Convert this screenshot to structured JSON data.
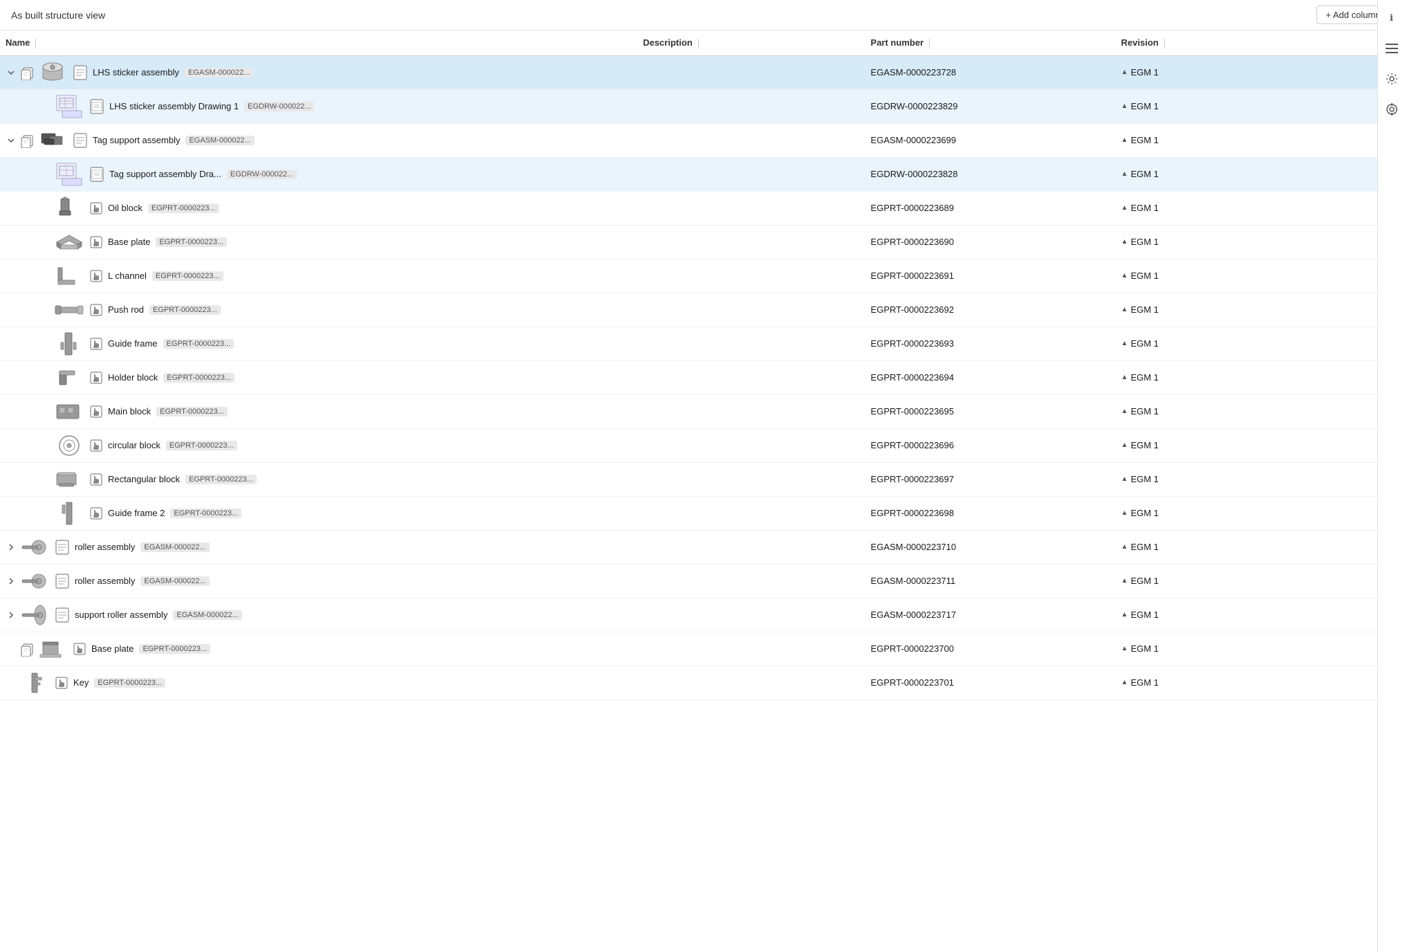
{
  "header": {
    "title": "As built structure view",
    "add_columns_label": "+ Add columns"
  },
  "columns": [
    {
      "key": "name",
      "label": "Name"
    },
    {
      "key": "description",
      "label": "Description"
    },
    {
      "key": "part_number",
      "label": "Part number"
    },
    {
      "key": "revision",
      "label": "Revision"
    }
  ],
  "rows": [
    {
      "id": 1,
      "indent": 0,
      "expandable": true,
      "expanded": true,
      "selected": true,
      "has_copy_icon": true,
      "has_thumbnail": true,
      "thumbnail_type": "assembly3d",
      "type": "assembly",
      "name": "LHS sticker assembly",
      "tag": "EGASM-000022...",
      "description": "",
      "part_number": "EGASM-0000223728",
      "revision": "EGM 1"
    },
    {
      "id": 2,
      "indent": 1,
      "expandable": false,
      "expanded": false,
      "selected": false,
      "light_selected": true,
      "has_thumbnail": true,
      "thumbnail_type": "drawing",
      "type": "document",
      "name": "LHS sticker assembly Drawing 1",
      "tag": "EGDRW-000022...",
      "description": "",
      "part_number": "EGDRW-0000223829",
      "revision": "EGM 1"
    },
    {
      "id": 3,
      "indent": 0,
      "expandable": true,
      "expanded": true,
      "selected": false,
      "has_copy_icon": true,
      "has_thumbnail": true,
      "thumbnail_type": "assembly3d_dark",
      "type": "assembly",
      "name": "Tag support assembly",
      "tag": "EGASM-000022...",
      "description": "",
      "part_number": "EGASM-0000223699",
      "revision": "EGM 1"
    },
    {
      "id": 4,
      "indent": 1,
      "expandable": false,
      "expanded": false,
      "selected": false,
      "light_selected": true,
      "has_thumbnail": true,
      "thumbnail_type": "drawing2",
      "type": "document",
      "name": "Tag support assembly Dra...",
      "tag": "EGDRW-000022...",
      "description": "",
      "part_number": "EGDRW-0000223828",
      "revision": "EGM 1"
    },
    {
      "id": 5,
      "indent": 1,
      "expandable": false,
      "selected": false,
      "has_thumbnail": true,
      "thumbnail_type": "part_oil",
      "type": "part",
      "name": "Oil block",
      "tag": "EGPRT-0000223...",
      "description": "",
      "part_number": "EGPRT-0000223689",
      "revision": "EGM 1"
    },
    {
      "id": 6,
      "indent": 1,
      "expandable": false,
      "selected": false,
      "has_thumbnail": true,
      "thumbnail_type": "part_base",
      "type": "part",
      "name": "Base plate",
      "tag": "EGPRT-0000223...",
      "description": "",
      "part_number": "EGPRT-0000223690",
      "revision": "EGM 1"
    },
    {
      "id": 7,
      "indent": 1,
      "expandable": false,
      "selected": false,
      "has_thumbnail": true,
      "thumbnail_type": "part_lchannel",
      "type": "part",
      "name": "L channel",
      "tag": "EGPRT-0000223...",
      "description": "",
      "part_number": "EGPRT-0000223691",
      "revision": "EGM 1"
    },
    {
      "id": 8,
      "indent": 1,
      "expandable": false,
      "selected": false,
      "has_thumbnail": true,
      "thumbnail_type": "part_pushrod",
      "type": "part",
      "name": "Push rod",
      "tag": "EGPRT-0000223...",
      "description": "",
      "part_number": "EGPRT-0000223692",
      "revision": "EGM 1"
    },
    {
      "id": 9,
      "indent": 1,
      "expandable": false,
      "selected": false,
      "has_thumbnail": true,
      "thumbnail_type": "part_guide",
      "type": "part",
      "name": "Guide frame",
      "tag": "EGPRT-0000223...",
      "description": "",
      "part_number": "EGPRT-0000223693",
      "revision": "EGM 1"
    },
    {
      "id": 10,
      "indent": 1,
      "expandable": false,
      "selected": false,
      "has_thumbnail": true,
      "thumbnail_type": "part_holder",
      "type": "part",
      "name": "Holder block",
      "tag": "EGPRT-0000223...",
      "description": "",
      "part_number": "EGPRT-0000223694",
      "revision": "EGM 1"
    },
    {
      "id": 11,
      "indent": 1,
      "expandable": false,
      "selected": false,
      "has_thumbnail": true,
      "thumbnail_type": "part_main",
      "type": "part",
      "name": "Main block",
      "tag": "EGPRT-0000223...",
      "description": "",
      "part_number": "EGPRT-0000223695",
      "revision": "EGM 1"
    },
    {
      "id": 12,
      "indent": 1,
      "expandable": false,
      "selected": false,
      "has_thumbnail": true,
      "thumbnail_type": "part_circular",
      "type": "part",
      "name": "circular block",
      "tag": "EGPRT-0000223...",
      "description": "",
      "part_number": "EGPRT-0000223696",
      "revision": "EGM 1"
    },
    {
      "id": 13,
      "indent": 1,
      "expandable": false,
      "selected": false,
      "has_thumbnail": true,
      "thumbnail_type": "part_rect",
      "type": "part",
      "name": "Rectangular block",
      "tag": "EGPRT-0000223...",
      "description": "",
      "part_number": "EGPRT-0000223697",
      "revision": "EGM 1"
    },
    {
      "id": 14,
      "indent": 1,
      "expandable": false,
      "selected": false,
      "has_thumbnail": true,
      "thumbnail_type": "part_guide2",
      "type": "part",
      "name": "Guide frame 2",
      "tag": "EGPRT-0000223...",
      "description": "",
      "part_number": "EGPRT-0000223698",
      "revision": "EGM 1"
    },
    {
      "id": 15,
      "indent": 0,
      "expandable": true,
      "expanded": false,
      "selected": false,
      "has_thumbnail": true,
      "thumbnail_type": "part_roller",
      "type": "assembly",
      "name": "roller assembly",
      "tag": "EGASM-000022...",
      "description": "",
      "part_number": "EGASM-0000223710",
      "revision": "EGM 1"
    },
    {
      "id": 16,
      "indent": 0,
      "expandable": true,
      "expanded": false,
      "selected": false,
      "has_thumbnail": true,
      "thumbnail_type": "part_roller2",
      "type": "assembly",
      "name": "roller assembly",
      "tag": "EGASM-000022...",
      "description": "",
      "part_number": "EGASM-0000223711",
      "revision": "EGM 1"
    },
    {
      "id": 17,
      "indent": 0,
      "expandable": true,
      "expanded": false,
      "selected": false,
      "has_thumbnail": true,
      "thumbnail_type": "part_support",
      "type": "assembly",
      "name": "support roller assembly",
      "tag": "EGASM-000022...",
      "description": "",
      "part_number": "EGASM-0000223717",
      "revision": "EGM 1"
    },
    {
      "id": 18,
      "indent": 0,
      "expandable": false,
      "selected": false,
      "has_copy_icon": true,
      "has_thumbnail": true,
      "thumbnail_type": "part_baseplate2",
      "type": "part",
      "name": "Base plate",
      "tag": "EGPRT-0000223...",
      "description": "",
      "part_number": "EGPRT-0000223700",
      "revision": "EGM 1"
    },
    {
      "id": 19,
      "indent": 0,
      "expandable": false,
      "selected": false,
      "has_thumbnail": true,
      "thumbnail_type": "part_key",
      "type": "part",
      "name": "Key",
      "tag": "EGPRT-0000223...",
      "description": "",
      "part_number": "EGPRT-0000223701",
      "revision": "EGM 1"
    }
  ],
  "sidebar_icons": [
    {
      "name": "info-icon",
      "symbol": "ℹ"
    },
    {
      "name": "list-icon",
      "symbol": "☰"
    },
    {
      "name": "settings-icon",
      "symbol": "⚙"
    },
    {
      "name": "target-icon",
      "symbol": "◎"
    }
  ]
}
